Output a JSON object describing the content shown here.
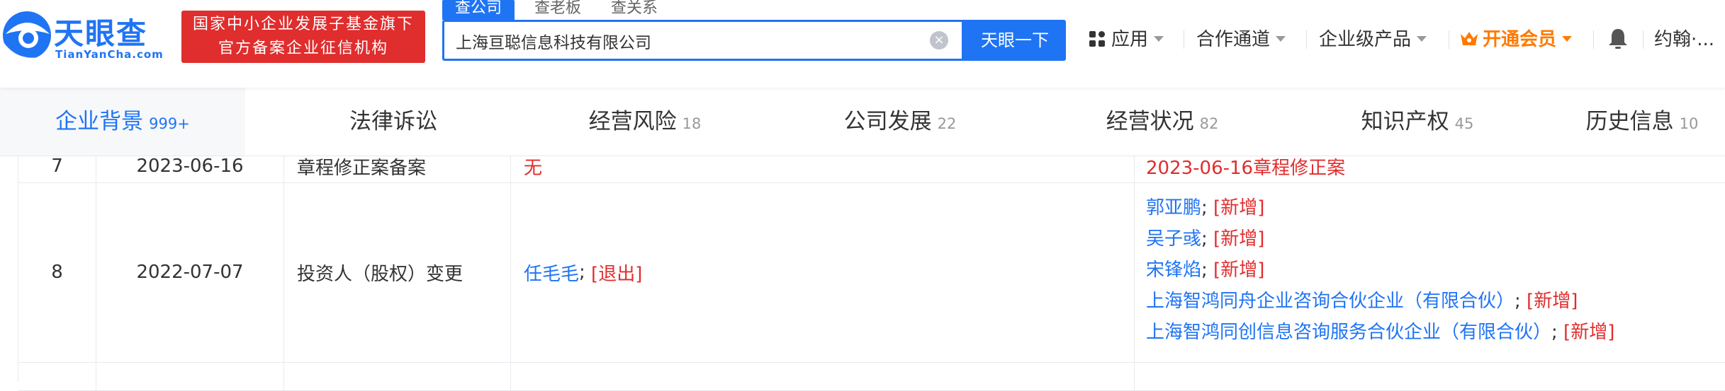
{
  "header": {
    "logo_cn": "天眼查",
    "logo_en": "TianYanCha.com",
    "badge_line1": "国家中小企业发展子基金旗下",
    "badge_line2": "官方备案企业征信机构",
    "search_tabs": [
      "查公司",
      "查老板",
      "查关系"
    ],
    "search_value": "上海亘聪信息科技有限公司",
    "search_button": "天眼一下",
    "nav": {
      "apps": "应用",
      "partner": "合作通道",
      "enterprise": "企业级产品",
      "vip": "开通会员",
      "user": "约翰·..."
    }
  },
  "tabs": [
    {
      "label": "企业背景",
      "count": "999+"
    },
    {
      "label": "法律诉讼",
      "count": ""
    },
    {
      "label": "经营风险",
      "count": "18"
    },
    {
      "label": "公司发展",
      "count": "22"
    },
    {
      "label": "经营状况",
      "count": "82"
    },
    {
      "label": "知识产权",
      "count": "45"
    },
    {
      "label": "历史信息",
      "count": "10"
    }
  ],
  "table": {
    "rows": [
      {
        "index": "7",
        "date": "2023-06-16",
        "type": "章程修正案备案",
        "before": "无",
        "after": "2023-06-16章程修正案"
      },
      {
        "index": "8",
        "date": "2022-07-07",
        "type": "投资人（股权）变更",
        "before_name": "任毛毛",
        "before_tag": "[退出]",
        "after": [
          {
            "name": "郭亚鹏",
            "tag": "[新增]"
          },
          {
            "name": "吴子彧",
            "tag": "[新增]"
          },
          {
            "name": "宋锋焰",
            "tag": "[新增]"
          },
          {
            "name": "上海智鸿同舟企业咨询合伙企业（有限合伙）",
            "tag": "[新增]"
          },
          {
            "name": "上海智鸿同创信息咨询服务合伙企业（有限合伙）",
            "tag": "[新增]"
          }
        ]
      }
    ]
  },
  "colors": {
    "brand_blue": "#1f74f4",
    "badge_red": "#e02d2d",
    "vip_orange": "#ff7a00",
    "tag_red": "#e02d2d"
  },
  "icons": [
    "tianyancha-logo-icon",
    "clear-icon",
    "apps-grid-icon",
    "crown-icon",
    "bell-icon",
    "chevron-down-icon"
  ]
}
